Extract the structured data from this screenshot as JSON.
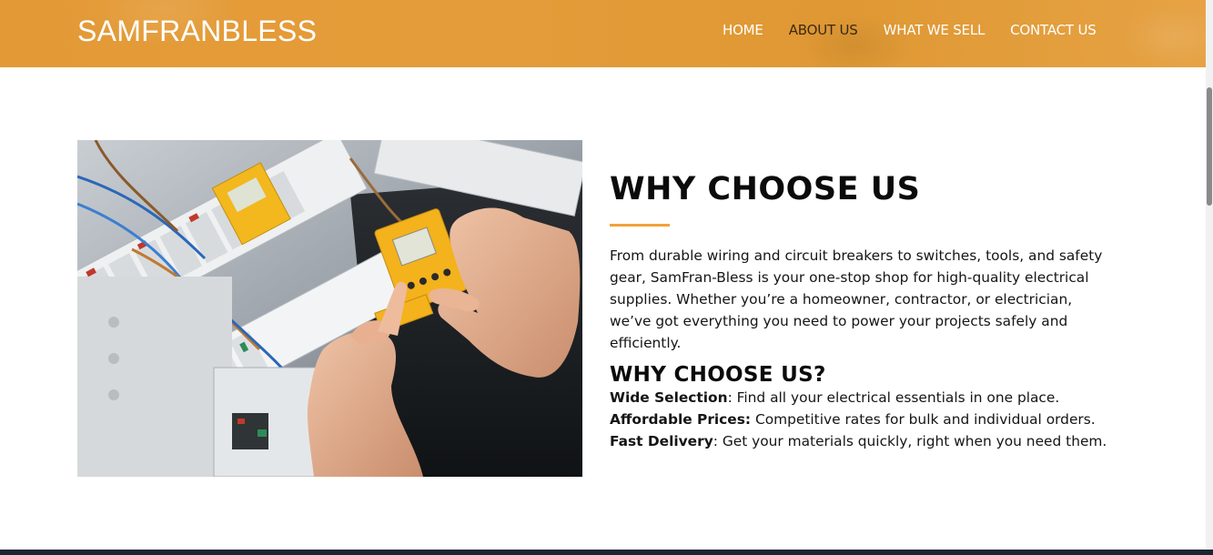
{
  "header": {
    "brand": "SAMFRANBLESS",
    "nav": [
      {
        "label": "HOME"
      },
      {
        "label": "ABOUT US",
        "active": true
      },
      {
        "label": "WHAT WE SELL"
      },
      {
        "label": "CONTACT US"
      }
    ]
  },
  "about": {
    "image_alt_icon": "electrician-hands-photo",
    "title": "WHY CHOOSE US",
    "paragraph": "From durable wiring and circuit breakers to switches, tools, and safety gear, SamFran-Bless is your one-stop shop for high-quality electrical supplies. Whether you’re a homeowner, contractor, or electrician, we’ve got everything you need to power your projects safely and efficiently.",
    "subtitle": "WHY CHOOSE US?",
    "features": [
      {
        "label": "Wide Selection",
        "sep": ":",
        "text": " Find all your electrical essentials in one place."
      },
      {
        "label": "Affordable Prices:",
        "sep": "",
        "text": " Competitive rates for bulk and individual orders."
      },
      {
        "label": "Fast Delivery",
        "sep": ":",
        "text": " Get your materials quickly, right when you need them."
      }
    ]
  },
  "colors": {
    "header": "#e39a36",
    "accent_rule": "#f2a13a",
    "footer": "#1b2531"
  }
}
